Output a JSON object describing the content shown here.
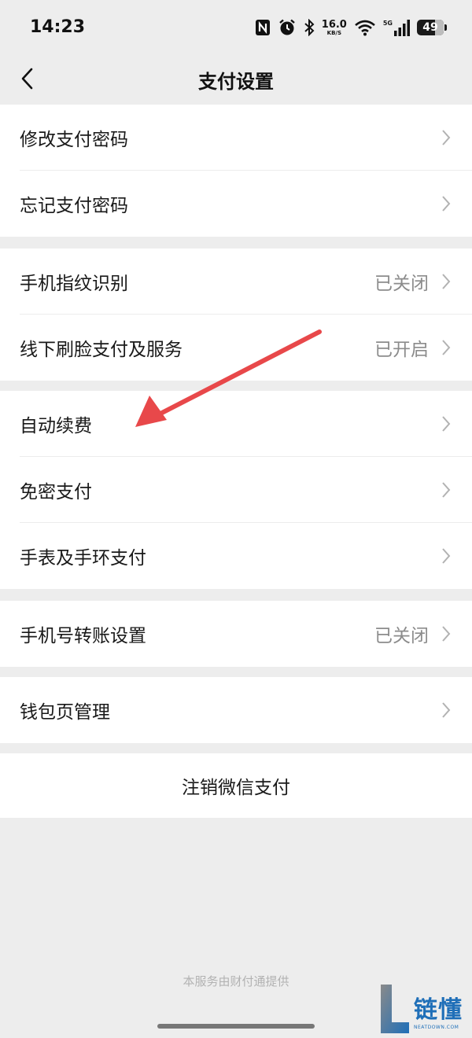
{
  "status_bar": {
    "time": "14:23",
    "net_speed_value": "16.0",
    "net_speed_unit": "KB/S",
    "network_label": "5G",
    "battery": "49"
  },
  "nav": {
    "title": "支付设置"
  },
  "groups": [
    {
      "rows": [
        {
          "label": "修改支付密码",
          "value": ""
        },
        {
          "label": "忘记支付密码",
          "value": ""
        }
      ]
    },
    {
      "rows": [
        {
          "label": "手机指纹识别",
          "value": "已关闭"
        },
        {
          "label": "线下刷脸支付及服务",
          "value": "已开启"
        }
      ]
    },
    {
      "rows": [
        {
          "label": "自动续费",
          "value": ""
        },
        {
          "label": "免密支付",
          "value": ""
        },
        {
          "label": "手表及手环支付",
          "value": ""
        }
      ]
    },
    {
      "rows": [
        {
          "label": "手机号转账设置",
          "value": "已关闭"
        }
      ]
    },
    {
      "rows": [
        {
          "label": "钱包页管理",
          "value": ""
        }
      ]
    }
  ],
  "deactivate": {
    "label": "注销微信支付"
  },
  "footer": {
    "note": "本服务由财付通提供"
  },
  "watermark": {
    "cn": "链懂",
    "en": "NEATDOWN.COM"
  },
  "colors": {
    "background": "#ededed",
    "card": "#ffffff",
    "text": "#191919",
    "secondary_text": "#8c8c8c",
    "annotation_arrow": "#e8484a",
    "watermark_blue": "#1f6fb8"
  },
  "icons": {
    "back": "chevron-left-icon",
    "row_chevron": "chevron-right-icon",
    "nfc": "nfc-icon",
    "alarm": "alarm-icon",
    "bluetooth": "bluetooth-icon",
    "wifi": "wifi-icon",
    "signal": "cell-signal-icon",
    "battery": "battery-icon"
  }
}
